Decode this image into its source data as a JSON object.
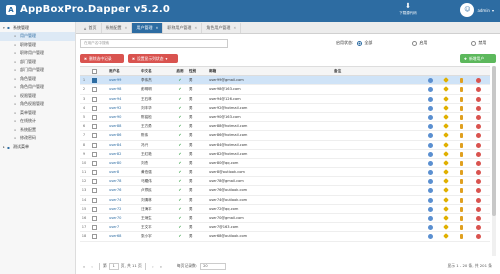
{
  "app": {
    "title": "AppBoxPro.Dapper v5.2.0",
    "logo_char": "A"
  },
  "header": {
    "download_label": "下载源代码",
    "user_name": "admin",
    "user_caret": "▾"
  },
  "sidebar": {
    "groups": [
      {
        "label": "系统管理",
        "expanded": true
      },
      {
        "label": "测试菜单",
        "expanded": false
      }
    ],
    "items": [
      {
        "label": "用户管理",
        "active": true
      },
      {
        "label": "职称管理",
        "active": false
      },
      {
        "label": "职称用户管理",
        "active": false
      },
      {
        "label": "部门管理",
        "active": false
      },
      {
        "label": "部门用户管理",
        "active": false
      },
      {
        "label": "角色管理",
        "active": false
      },
      {
        "label": "角色用户管理",
        "active": false
      },
      {
        "label": "权限管理",
        "active": false
      },
      {
        "label": "角色权限管理",
        "active": false
      },
      {
        "label": "菜单管理",
        "active": false
      },
      {
        "label": "在线统计",
        "active": false
      },
      {
        "label": "系统配置",
        "active": false
      },
      {
        "label": "修改密码",
        "active": false
      }
    ]
  },
  "tabs": [
    {
      "label": "首页",
      "closable": false,
      "active": false
    },
    {
      "label": "系统配置",
      "closable": true,
      "active": false
    },
    {
      "label": "用户管理",
      "closable": true,
      "active": true
    },
    {
      "label": "职称用户管理",
      "closable": true,
      "active": false
    },
    {
      "label": "角色用户管理",
      "closable": true,
      "active": false
    }
  ],
  "filter": {
    "search_placeholder": "在用户名中搜索",
    "status_label": "启用状态:",
    "options": [
      "全部",
      "启用",
      "禁用"
    ],
    "selected": "全部"
  },
  "toolbar": {
    "delete_label": "删除选中记录",
    "columns_label": "设置显示列状态",
    "add_label": "新增用户"
  },
  "grid": {
    "columns": [
      "用户名",
      "中文名",
      "启用",
      "性别",
      "邮箱",
      "备注"
    ],
    "rows": [
      {
        "index": "1",
        "username": "user99",
        "cn": "李伟杰",
        "enabled": true,
        "sex": "男",
        "email": "user99@gmail.com",
        "selected": true
      },
      {
        "index": "2",
        "username": "user98",
        "cn": "彭明明",
        "enabled": true,
        "sex": "男",
        "email": "user98@163.com",
        "selected": false
      },
      {
        "index": "3",
        "username": "user94",
        "cn": "王石林",
        "enabled": true,
        "sex": "男",
        "email": "user94@126.com",
        "selected": false
      },
      {
        "index": "4",
        "username": "user92",
        "cn": "刘丰华",
        "enabled": true,
        "sex": "男",
        "email": "user92@hotmail.com",
        "selected": false
      },
      {
        "index": "5",
        "username": "user90",
        "cn": "陈铭松",
        "enabled": true,
        "sex": "男",
        "email": "user90@163.com",
        "selected": false
      },
      {
        "index": "6",
        "username": "user88",
        "cn": "王方勇",
        "enabled": true,
        "sex": "男",
        "email": "user88@hotmail.com",
        "selected": false
      },
      {
        "index": "7",
        "username": "user86",
        "cn": "陈伟",
        "enabled": true,
        "sex": "男",
        "email": "user86@hotmail.com",
        "selected": false
      },
      {
        "index": "8",
        "username": "user84",
        "cn": "冯兴",
        "enabled": true,
        "sex": "男",
        "email": "user84@hotmail.com",
        "selected": false
      },
      {
        "index": "9",
        "username": "user82",
        "cn": "王红艳",
        "enabled": true,
        "sex": "男",
        "email": "user82@hotmail.com",
        "selected": false
      },
      {
        "index": "10",
        "username": "user80",
        "cn": "刘杰",
        "enabled": true,
        "sex": "男",
        "email": "user80@qq.com",
        "selected": false
      },
      {
        "index": "11",
        "username": "user8",
        "cn": "黄伯强",
        "enabled": true,
        "sex": "男",
        "email": "user8@outlook.com",
        "selected": false
      },
      {
        "index": "12",
        "username": "user78",
        "cn": "马耀伟",
        "enabled": true,
        "sex": "男",
        "email": "user78@gmail.com",
        "selected": false
      },
      {
        "index": "13",
        "username": "user76",
        "cn": "卢郑民",
        "enabled": true,
        "sex": "男",
        "email": "user76@outlook.com",
        "selected": false
      },
      {
        "index": "14",
        "username": "user74",
        "cn": "刘清林",
        "enabled": true,
        "sex": "男",
        "email": "user74@outlook.com",
        "selected": false
      },
      {
        "index": "15",
        "username": "user72",
        "cn": "汪海平",
        "enabled": true,
        "sex": "男",
        "email": "user72@qq.com",
        "selected": false
      },
      {
        "index": "16",
        "username": "user70",
        "cn": "王炳生",
        "enabled": true,
        "sex": "男",
        "email": "user70@gmail.com",
        "selected": false
      },
      {
        "index": "17",
        "username": "user7",
        "cn": "王文平",
        "enabled": true,
        "sex": "男",
        "email": "user7@163.com",
        "selected": false
      },
      {
        "index": "18",
        "username": "user68",
        "cn": "张小宇",
        "enabled": true,
        "sex": "男",
        "email": "user68@outlook.com",
        "selected": false
      }
    ]
  },
  "pager": {
    "page_label_pre": "第",
    "page": "1",
    "page_label_post": "页, 共 11 页",
    "page_size_label": "每页记录数:",
    "page_size": "20",
    "info": "显示 1 - 20 条, 共 201 条"
  },
  "colors": {
    "primary": "#2d6ca2",
    "danger": "#d9534f",
    "success": "#5cb85c"
  }
}
